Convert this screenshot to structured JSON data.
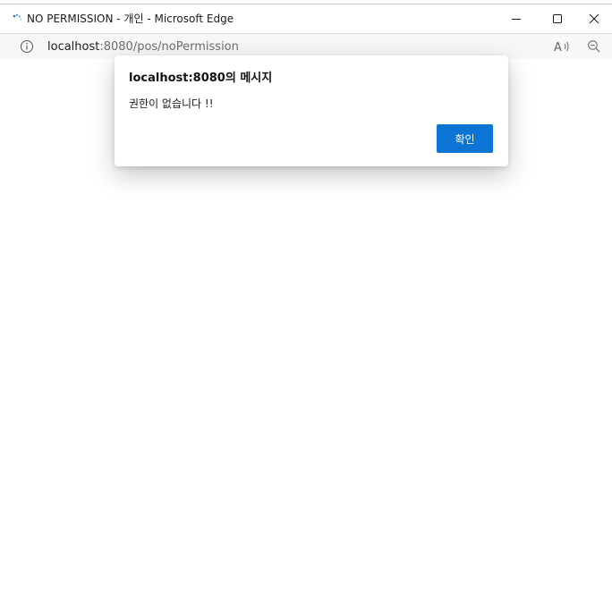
{
  "window": {
    "title": "NO PERMISSION - 개인 - Microsoft Edge",
    "icons": {
      "app": "edge-loading-icon",
      "minimize": "minimize-icon",
      "maximize": "maximize-icon",
      "close": "close-icon"
    }
  },
  "addressbar": {
    "url_host": "localhost",
    "url_rest": ":8080/pos/noPermission",
    "icons": {
      "info": "info-icon",
      "read_aloud": "read-aloud-icon",
      "zoom": "zoom-out-icon"
    }
  },
  "dialog": {
    "title": "localhost:8080의 메시지",
    "message": "권한이 없습니다 !!",
    "ok_label": "확인"
  },
  "colors": {
    "accent": "#0b74d4",
    "title_text": "#1b1b1b",
    "url_muted": "#6d6d6d"
  }
}
